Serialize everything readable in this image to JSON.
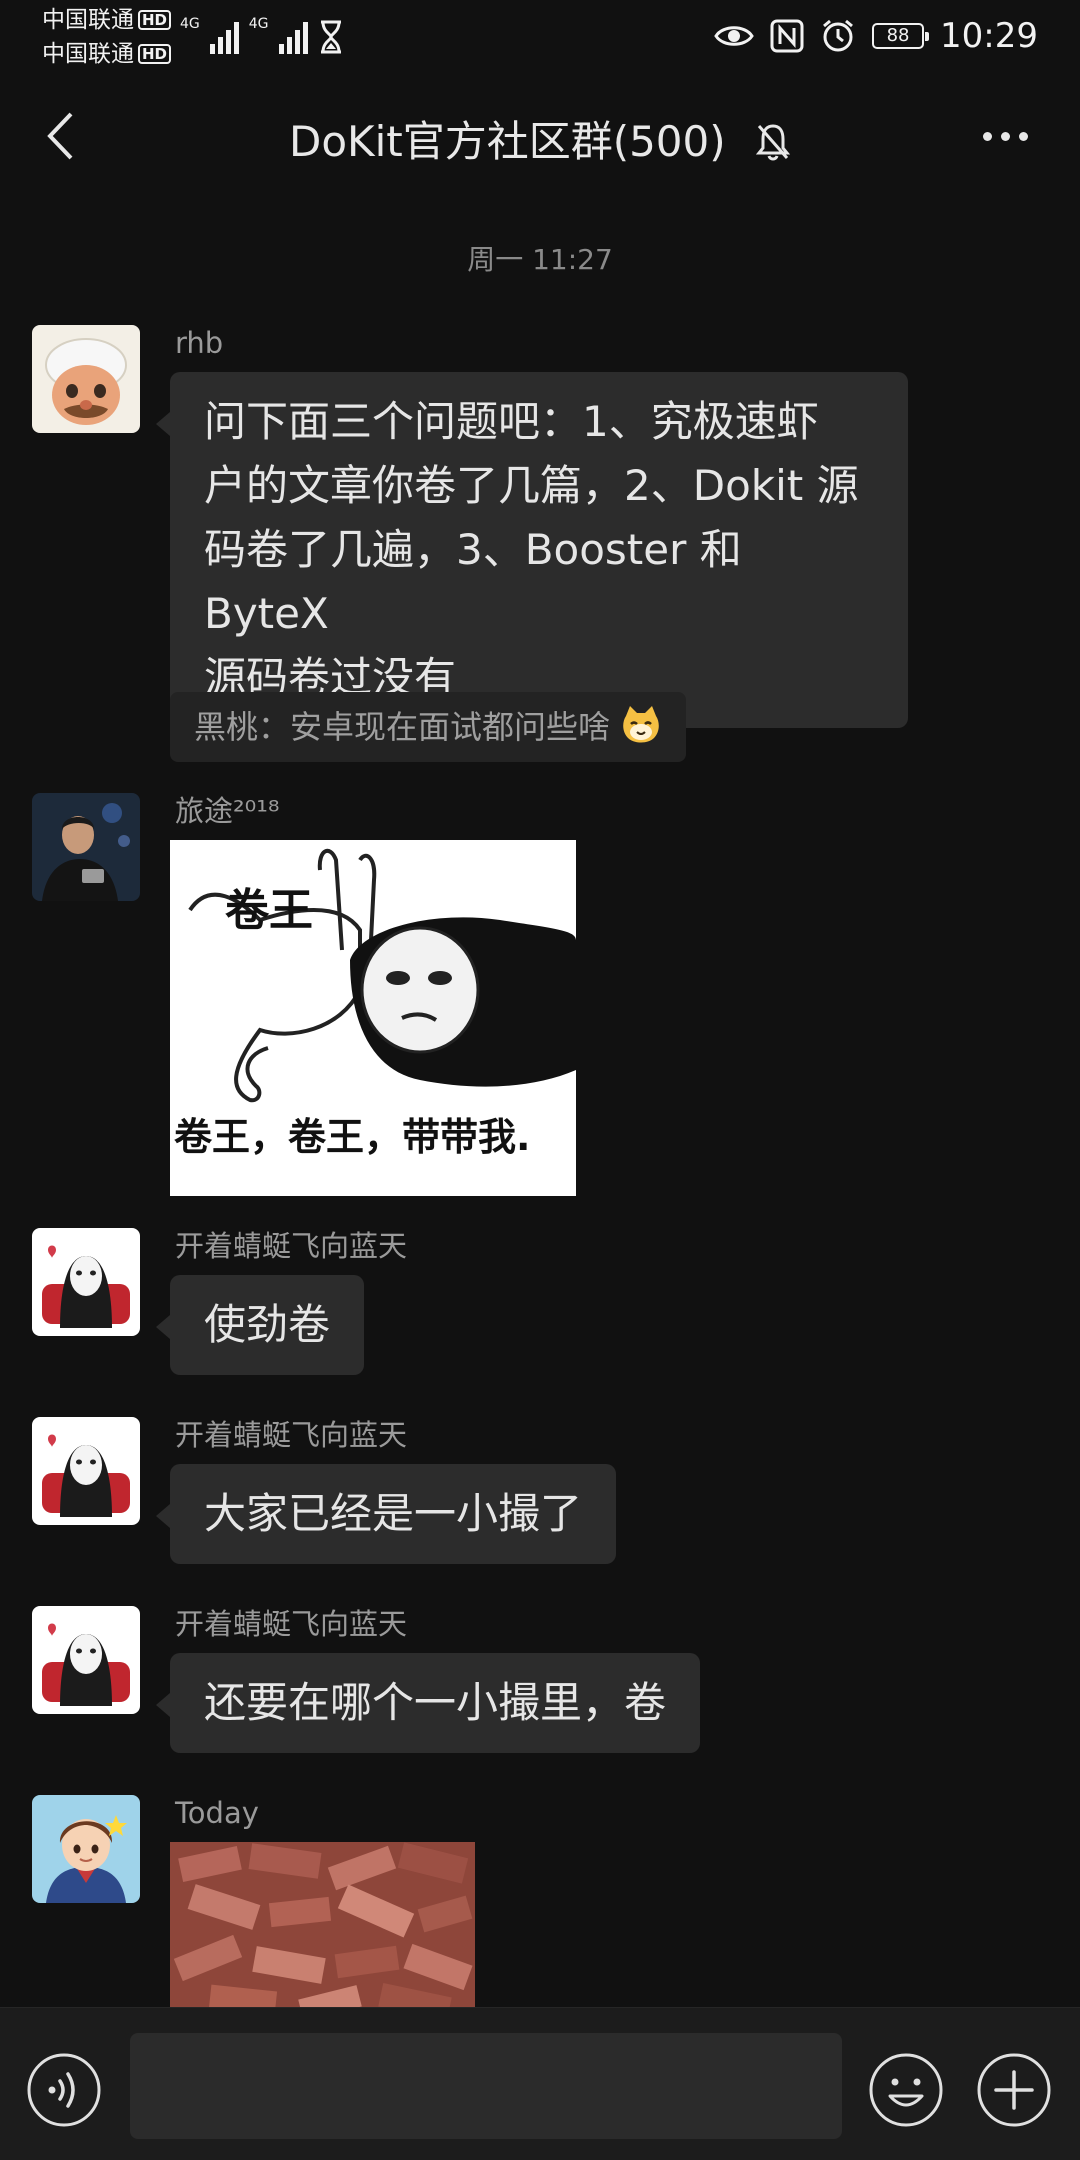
{
  "status_bar": {
    "carrier1": "中国联通",
    "carrier2": "中国联通",
    "hd": "HD",
    "network1": "4G",
    "network2": "4G",
    "battery": "88",
    "time": "10:29"
  },
  "header": {
    "title": "DoKit官方社区群(500)"
  },
  "timestamp": "周一 11:27",
  "messages": [
    {
      "sender": "rhb",
      "text": "问下面三个问题吧：1、究极速虾户的文章你卷了几篇，2、Dokit 源码卷了几遍，3、Booster 和 ByteX 源码卷过没有",
      "lines": [
        "问下面三个问题吧：1、究极速虾",
        "户的文章你卷了几篇，2、Dokit 源",
        "码卷了几遍，3、Booster 和 ByteX",
        "源码卷过没有"
      ],
      "quote": "黑桃：安卓现在面试都问些啥"
    },
    {
      "sender": "旅途²⁰¹⁸",
      "image_text_1": "卷王",
      "image_text_2": "卷王，卷王，带带我."
    },
    {
      "sender": "开着蜻蜓飞向蓝天",
      "text": "使劲卷"
    },
    {
      "sender": "开着蜻蜓飞向蓝天",
      "text": "大家已经是一小撮了"
    },
    {
      "sender": "开着蜻蜓飞向蓝天",
      "text": "还要在哪个一小撮里，卷"
    },
    {
      "sender": "Today"
    }
  ],
  "input": {
    "value": "",
    "placeholder": ""
  },
  "colors": {
    "background": "#111111",
    "bubble": "#2c2c2c",
    "text": "#e6e6e6",
    "secondary": "#9a9a9a"
  }
}
